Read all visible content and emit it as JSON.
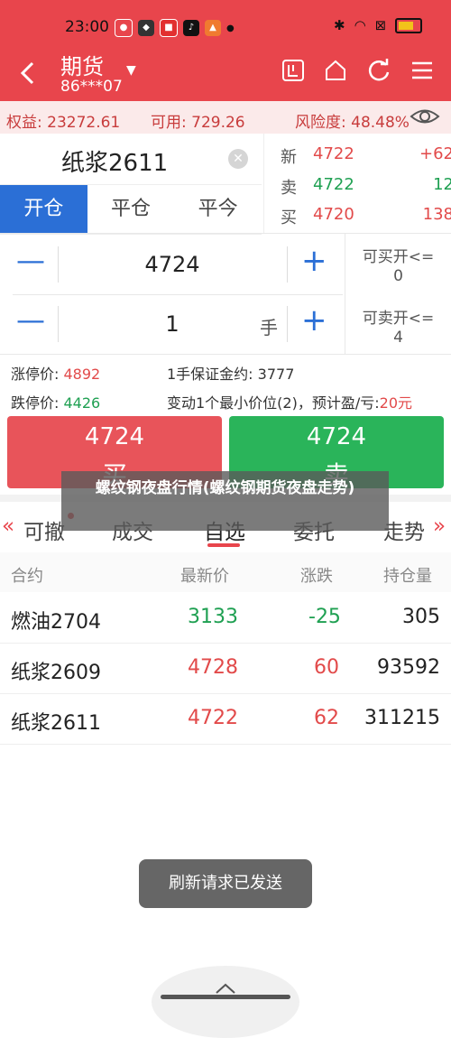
{
  "status": {
    "time": "23:00",
    "battery_color": "#f2c21a"
  },
  "header": {
    "title": "期货",
    "account": "86***07",
    "back_icon": "back-icon",
    "icons": [
      "tradingview-icon",
      "home-icon",
      "refresh-icon",
      "menu-icon"
    ]
  },
  "account_bar": {
    "equity": "权益: 23272.61",
    "available": "可用: 729.26",
    "risk": "风险度: 48.48%"
  },
  "order": {
    "symbol": "纸浆2611",
    "tabs": [
      "开仓",
      "平仓",
      "平今"
    ],
    "active_tab": 0,
    "price": "4724",
    "qty": "1",
    "qty_unit": "手",
    "can_buy_label": "可买开<=",
    "can_buy_value": "0",
    "can_sell_label": "可卖开<=",
    "can_sell_value": "4"
  },
  "quote": [
    {
      "label": "新",
      "price": "4722",
      "change": "+62",
      "color": "#e24a4a"
    },
    {
      "label": "卖",
      "price": "4722",
      "change": "12",
      "color": "#1fa052"
    },
    {
      "label": "买",
      "price": "4720",
      "change": "138",
      "color": "#e24a4a"
    }
  ],
  "info": {
    "limit_up_label": "涨停价:",
    "limit_up": "4892",
    "margin_label": "1手保证金约:",
    "margin": "3777",
    "limit_down_label": "跌停价:",
    "limit_down": "4426",
    "tick_label": "变动1个最小价位(2)，预计盈/亏:",
    "tick_value": "20元"
  },
  "buttons": {
    "buy_price": "4724",
    "buy_label": "买",
    "sell_price": "4724",
    "sell_label": "卖",
    "buy_color": "#e8545a",
    "sell_color": "#2ab45a"
  },
  "watermark": "螺纹钢夜盘行情(螺纹钢期货夜盘走势)",
  "lower_tabs": {
    "left_arrow": "«",
    "items": [
      "可撤",
      "成交",
      "自选",
      "委托",
      "走势"
    ],
    "right_arrow": "»",
    "active": 2
  },
  "table": {
    "headers": [
      "合约",
      "最新价",
      "涨跌",
      "持仓量"
    ],
    "rows": [
      {
        "name": "燃油2704",
        "price": "3133",
        "change": "-25",
        "oi": "305",
        "dir": "down"
      },
      {
        "name": "纸浆2609",
        "price": "4728",
        "change": "60",
        "oi": "93592",
        "dir": "up"
      },
      {
        "name": "纸浆2611",
        "price": "4722",
        "change": "62",
        "oi": "311215",
        "dir": "up"
      }
    ]
  },
  "toast": "刷新请求已发送"
}
